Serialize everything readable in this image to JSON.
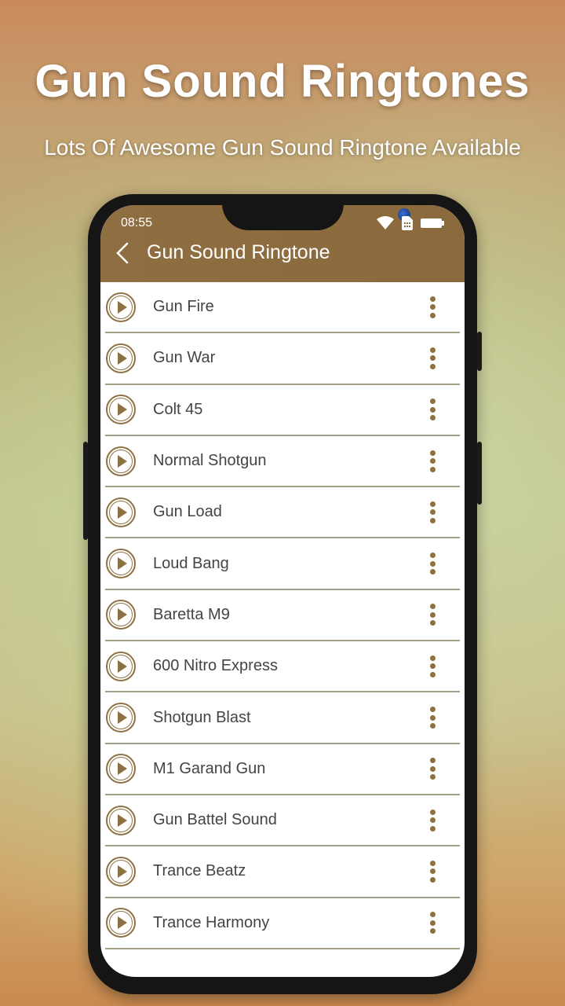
{
  "promo": {
    "title": "Gun Sound Ringtones",
    "subtitle": "Lots Of Awesome Gun Sound Ringtone Available"
  },
  "status_bar": {
    "time": "08:55",
    "icons": [
      "wifi-icon",
      "sim-icon",
      "battery-icon"
    ]
  },
  "app_bar": {
    "back_icon": "chevron-left-icon",
    "title": "Gun Sound Ringtone"
  },
  "colors": {
    "accent": "#8d7143",
    "app_bar": "#8c6c3f",
    "divider": "#a39f88",
    "text": "#444444"
  },
  "ringtones": [
    {
      "label": "Gun Fire"
    },
    {
      "label": "Gun War"
    },
    {
      "label": "Colt 45"
    },
    {
      "label": "Normal Shotgun"
    },
    {
      "label": "Gun Load"
    },
    {
      "label": "Loud Bang"
    },
    {
      "label": "Baretta M9"
    },
    {
      "label": "600 Nitro Express"
    },
    {
      "label": "Shotgun Blast"
    },
    {
      "label": "M1 Garand Gun"
    },
    {
      "label": "Gun Battel Sound"
    },
    {
      "label": "Trance Beatz"
    },
    {
      "label": "Trance Harmony"
    }
  ]
}
